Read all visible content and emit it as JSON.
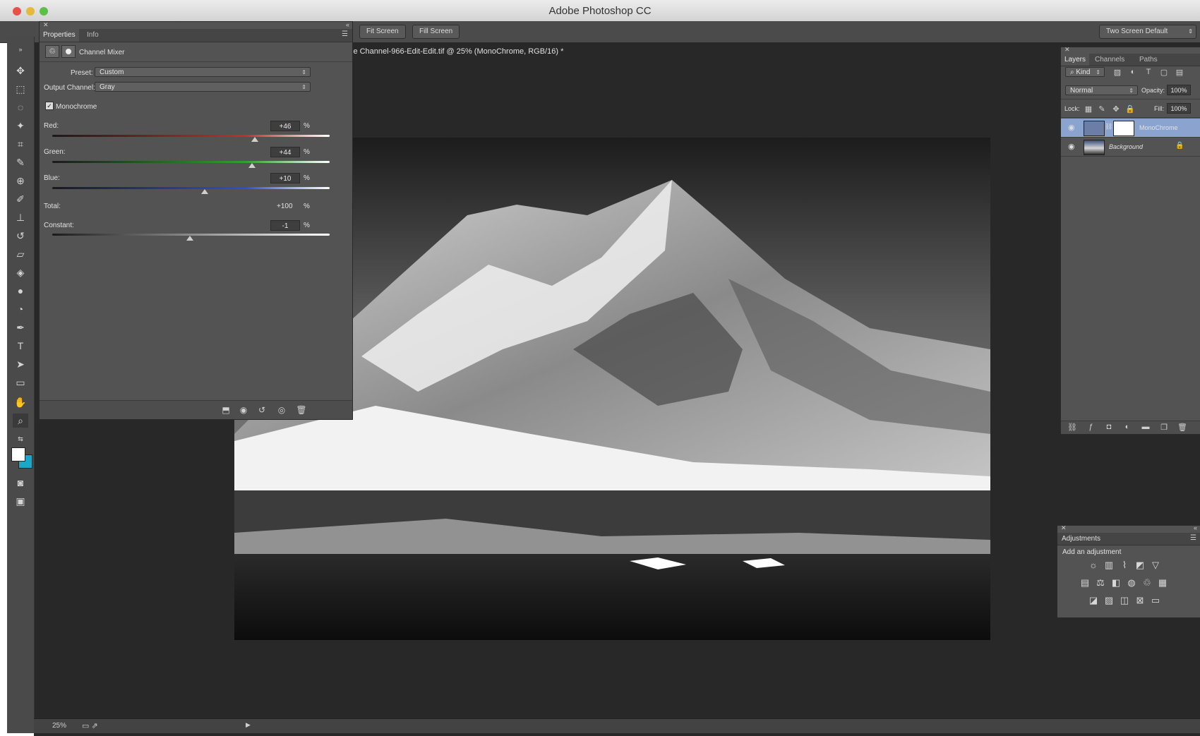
{
  "window": {
    "title": "Adobe Photoshop CC"
  },
  "options_bar": {
    "fit_screen": "Fit Screen",
    "fill_screen": "Fill Screen",
    "workspace": "Two Screen Default"
  },
  "document": {
    "tab_title": "le Channel-966-Edit-Edit.tif @ 25% (MonoChrome, RGB/16) *",
    "zoom": "25%"
  },
  "properties": {
    "tabs": [
      "Properties",
      "Info"
    ],
    "adjustment_name": "Channel Mixer",
    "preset_label": "Preset:",
    "preset_value": "Custom",
    "output_label": "Output Channel:",
    "output_value": "Gray",
    "monochrome_label": "Monochrome",
    "monochrome_checked": true,
    "channels": [
      {
        "label": "Red:",
        "value": "+46",
        "unit": "%",
        "level": 0.73,
        "track": "#c03030"
      },
      {
        "label": "Green:",
        "value": "+44",
        "unit": "%",
        "level": 0.72,
        "track": "#30a030"
      },
      {
        "label": "Blue:",
        "value": "+10",
        "unit": "%",
        "level": 0.55,
        "track": "#3050d0"
      }
    ],
    "total_label": "Total:",
    "total_value": "+100",
    "total_unit": "%",
    "constant_label": "Constant:",
    "constant_value": "-1",
    "constant_unit": "%",
    "constant_level": 0.495
  },
  "layers_panel": {
    "tabs": [
      "Layers",
      "Channels",
      "Paths"
    ],
    "kind": "Kind",
    "blend_mode": "Normal",
    "opacity_label": "Opacity:",
    "opacity_value": "100%",
    "lock_label": "Lock:",
    "fill_label": "Fill:",
    "fill_value": "100%",
    "layers": [
      {
        "name": "MonoChrome",
        "selected": true
      },
      {
        "name": "Background",
        "selected": false
      }
    ]
  },
  "adjustments_panel": {
    "title": "Adjustments",
    "subtitle": "Add an adjustment"
  },
  "colors": {
    "foreground": "#ffffff",
    "background": "#1aa7c9",
    "selection": "#8aa4cf"
  }
}
